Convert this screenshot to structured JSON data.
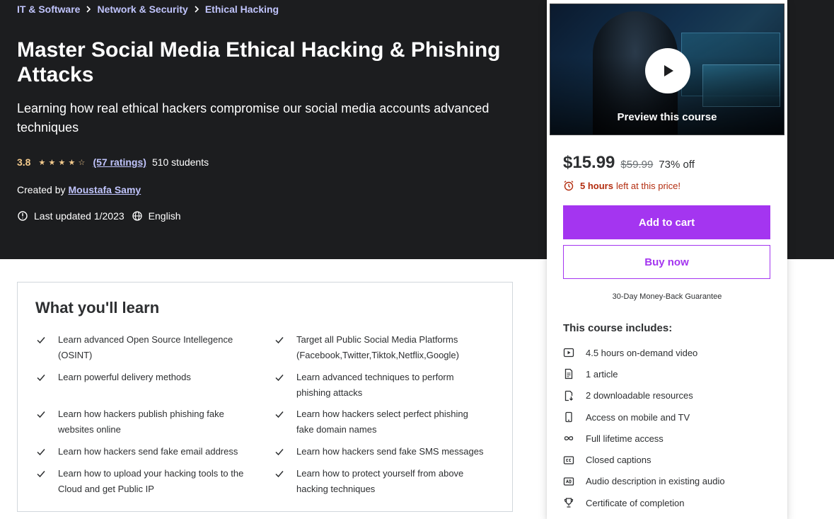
{
  "breadcrumb": [
    "IT & Software",
    "Network & Security",
    "Ethical Hacking"
  ],
  "course": {
    "title": "Master Social Media Ethical Hacking & Phishing Attacks",
    "subtitle": "Learning how real ethical hackers compromise our social media accounts advanced techniques",
    "rating": "3.8",
    "rating_value": 3.8,
    "ratings_count": "(57 ratings)",
    "students": "510 students",
    "created_by_label": "Created by",
    "author": "Moustafa Samy",
    "last_updated": "Last updated 1/2023",
    "language": "English"
  },
  "sidebar": {
    "preview_label": "Preview this course",
    "price": "$15.99",
    "original_price": "$59.99",
    "discount": "73% off",
    "timer_hours": "5 hours",
    "timer_text": "left at this price!",
    "add_to_cart": "Add to cart",
    "buy_now": "Buy now",
    "guarantee": "30-Day Money-Back Guarantee",
    "includes_title": "This course includes:",
    "includes": [
      {
        "icon": "video-icon",
        "text": "4.5 hours on-demand video"
      },
      {
        "icon": "article-icon",
        "text": "1 article"
      },
      {
        "icon": "download-icon",
        "text": "2 downloadable resources"
      },
      {
        "icon": "mobile-icon",
        "text": "Access on mobile and TV"
      },
      {
        "icon": "infinity-icon",
        "text": "Full lifetime access"
      },
      {
        "icon": "captions-icon",
        "text": "Closed captions"
      },
      {
        "icon": "audio-description-icon",
        "text": "Audio description in existing audio"
      },
      {
        "icon": "trophy-icon",
        "text": "Certificate of completion"
      }
    ]
  },
  "learn": {
    "title": "What you'll learn",
    "items": [
      "Learn advanced Open Source Intellegence (OSINT)",
      "Target all Public Social Media Platforms (Facebook,Twitter,Tiktok,Netflix,Google)",
      "Learn powerful delivery methods",
      "Learn advanced techniques to perform phishing attacks",
      "Learn how hackers publish phishing fake websites online",
      "Learn how hackers select perfect phishing fake domain names",
      "Learn how hackers send fake email address",
      "Learn how hackers send fake SMS messages",
      "Learn how to upload your hacking tools to the Cloud and get Public IP",
      "Learn how to protect yourself from above hacking techniques"
    ]
  },
  "colors": {
    "hero_bg": "#1c1d1f",
    "accent": "#a435f0",
    "link": "#c0c4fc",
    "star": "#f3ca8c",
    "timer": "#b32d0f"
  }
}
